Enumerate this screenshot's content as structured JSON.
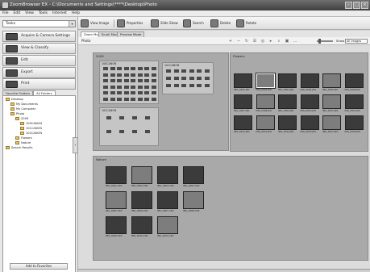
{
  "window": {
    "title": "ZoomBrowser EX - C:\\Documents and Settings\\****\\Desktop\\Photo",
    "buttons": [
      "–",
      "□",
      "×"
    ]
  },
  "menu": [
    "File",
    "Edit",
    "View",
    "Tools",
    "Internet",
    "Help"
  ],
  "left_panel": {
    "tasks_label": "Tasks",
    "task_buttons": [
      "Acquire & Camera Settings",
      "View & Classify",
      "Edit",
      "Export",
      "Print",
      "Internet"
    ],
    "tabs": [
      "Favorite Folders",
      "All Folders"
    ],
    "tree": [
      "Desktop",
      "My Documents",
      "My Computer",
      "Photo",
      "2009",
      "100CANON",
      "101CANON",
      "102CANON",
      "Flowers",
      "Nature",
      "Search Results"
    ],
    "add_favorites": "Add to Favorites"
  },
  "toolbar": {
    "buttons": [
      "View Image",
      "Properties",
      "Slide Show",
      "Search",
      "Delete",
      "Rotate"
    ]
  },
  "view_tabs": [
    "Zoom Mode",
    "Scroll Mode",
    "Preview Mode"
  ],
  "mode_bar": {
    "location_label": "Photo",
    "show_label": "Show",
    "show_value": "All Images",
    "tool_glyphs": [
      "+",
      "−",
      "↻",
      "☰",
      "◎",
      "▸",
      "⌕",
      "▣",
      "…"
    ]
  },
  "browse": {
    "folders": [
      {
        "name": "2009",
        "subfolders": [
          "100CANON",
          "101CANON",
          "102CANON"
        ]
      },
      {
        "name": "Flowers",
        "captions": [
          "IMG_0001.JPG",
          "IMG_0002.JPG",
          "IMG_0003.JPG",
          "IMG_0004.JPG",
          "IMG_0005.JPG",
          "IMG_0006.JPG",
          "IMG_0007.JPG",
          "IMG_0008.JPG",
          "IMG_0009.JPG",
          "IMG_0010.JPG",
          "IMG_0011.JPG",
          "IMG_0012.JPG",
          "IMG_0013.JPG",
          "IMG_0014.JPG",
          "IMG_0015.JPG",
          "IMG_0016.JPG",
          "IMG_0017.JPG",
          "IMG_0018.JPG"
        ]
      },
      {
        "name": "Nature",
        "captions": [
          "IMG_0001.CR2",
          "IMG_0002.CR2",
          "IMG_0003.CR2",
          "IMG_0004.CR2",
          "IMG_0005.CR2",
          "IMG_0006.CR2",
          "IMG_0007.CR2",
          "IMG_0008.CR2",
          "IMG_0009.CR2",
          "IMG_0010.CR2",
          "IMG_0011.CR2"
        ]
      }
    ]
  }
}
